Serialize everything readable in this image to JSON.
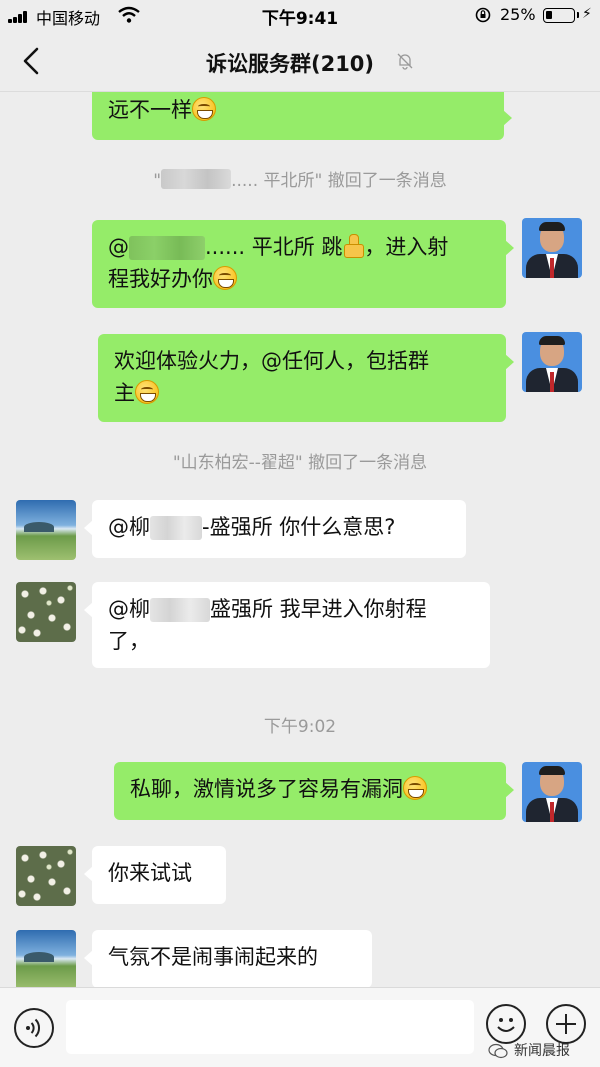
{
  "status_bar": {
    "carrier": "中国移动",
    "time": "下午9:41",
    "battery_percent": "25%",
    "battery_level": 0.25
  },
  "nav": {
    "title": "诉讼服务群(210)",
    "back_icon": "chevron-left-icon",
    "mute_icon": "bell-off-icon"
  },
  "messages": {
    "m1": {
      "text": "远不一样"
    },
    "recall1": {
      "prefix": "\"",
      "suffix": "..... 平北所\" 撤回了一条消息"
    },
    "m2": {
      "prefix": "@",
      "line1_rest": "...... 平北所 跳",
      "line1_end": "，进入射",
      "line2": "程我好办你"
    },
    "m3": {
      "line1": "欢迎体验火力，@任何人，包括群",
      "line2": "主"
    },
    "recall2": {
      "text": "\"山东柏宏--翟超\" 撤回了一条消息"
    },
    "m4": {
      "prefix": "@柳",
      "rest": "-盛强所 你什么意思?"
    },
    "m5": {
      "prefix": "@柳",
      "rest": "盛强所 我早进入你射程",
      "line2": "了，"
    },
    "time_divider": "下午9:02",
    "m6": {
      "text": "私聊，激情说多了容易有漏洞"
    },
    "m7": {
      "text": "你来试试"
    },
    "m8": {
      "text": "气氛不是闹事闹起来的"
    }
  },
  "colors": {
    "sent_bubble": "#95ec69",
    "received_bubble": "#ffffff",
    "background": "#ededed"
  },
  "watermark": {
    "text": "新闻晨报"
  }
}
